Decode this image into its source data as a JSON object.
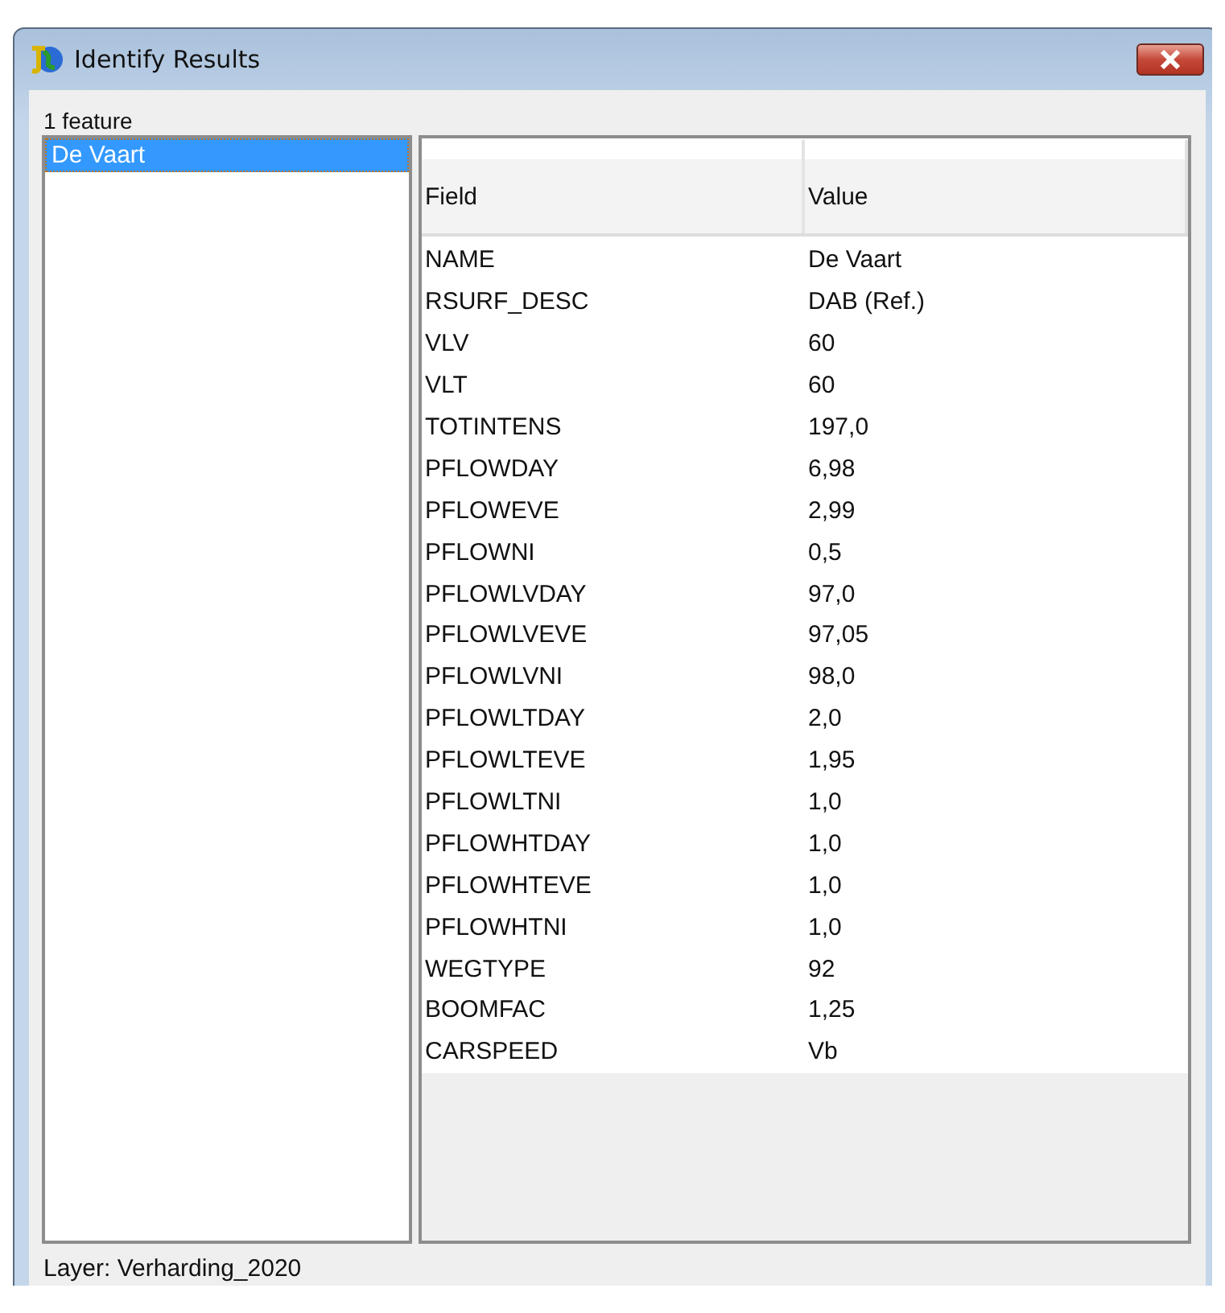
{
  "window": {
    "title": "Identify Results"
  },
  "feature_count": "1 feature",
  "features": [
    {
      "label": "De Vaart",
      "selected": true
    }
  ],
  "table": {
    "columns": [
      "Field",
      "Value"
    ],
    "rows": [
      [
        "NAME",
        "De Vaart"
      ],
      [
        "RSURF_DESC",
        "DAB (Ref.)"
      ],
      [
        "VLV",
        "60"
      ],
      [
        "VLT",
        "60"
      ],
      [
        "TOTINTENS",
        "197,0"
      ],
      [
        "PFLOWDAY",
        "6,98"
      ],
      [
        "PFLOWEVE",
        "2,99"
      ],
      [
        "PFLOWNI",
        "0,5"
      ],
      [
        "PFLOWLVDAY",
        "97,0"
      ],
      [
        "PFLOWLVEVE",
        "97,05"
      ],
      [
        "PFLOWLVNI",
        "98,0"
      ],
      [
        "PFLOWLTDAY",
        "2,0"
      ],
      [
        "PFLOWLTEVE",
        "1,95"
      ],
      [
        "PFLOWLTNI",
        "1,0"
      ],
      [
        "PFLOWHTDAY",
        "1,0"
      ],
      [
        "PFLOWHTEVE",
        "1,0"
      ],
      [
        "PFLOWHTNI",
        "1,0"
      ],
      [
        "WEGTYPE",
        "92"
      ],
      [
        "BOOMFAC",
        "1,25"
      ],
      [
        "CARSPEED",
        "Vb"
      ]
    ]
  },
  "status": "Layer: Verharding_2020"
}
